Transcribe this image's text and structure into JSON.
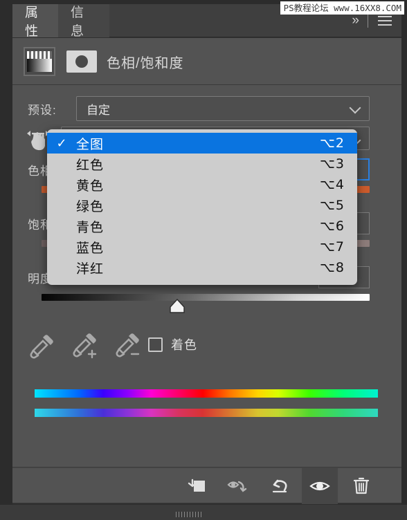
{
  "window": {
    "watermark": "PS教程论坛 www.16XX8.COM"
  },
  "tabs": [
    {
      "label": "属性",
      "active": true
    },
    {
      "label": "信息",
      "active": false
    }
  ],
  "tabbar_controls": {
    "overflow_label": "»",
    "menu_icon": "hamburger-icon"
  },
  "adjustment": {
    "title": "色相/饱和度",
    "layer_thumb_icon": "gradient-adjustment-thumbnail",
    "mask_thumb_icon": "layer-mask-thumbnail"
  },
  "preset": {
    "label": "预设:",
    "value": "自定",
    "chevron_icon": "chevron-down-icon"
  },
  "range": {
    "scrubby_icon": "scrubby-hand-icon",
    "chevron_icon": "chevron-down-icon",
    "selected": "全图"
  },
  "sliders": [
    {
      "name": "hue",
      "label": "色相:",
      "value": "",
      "focused": true
    },
    {
      "name": "saturation",
      "label": "饱和度",
      "value": "",
      "focused": false
    },
    {
      "name": "lightness",
      "label": "明度:",
      "value": "0",
      "focused": false
    }
  ],
  "tools": {
    "eyedropper_icon": "eyedropper-icon",
    "eyedropper_add_icon": "eyedropper-plus-icon",
    "eyedropper_subtract_icon": "eyedropper-minus-icon",
    "colorize_label": "着色",
    "colorize_checked": false
  },
  "menu": {
    "items": [
      {
        "label": "全图",
        "shortcut": "⌥2",
        "checked": true,
        "selected": true
      },
      {
        "label": "红色",
        "shortcut": "⌥3",
        "checked": false,
        "selected": false
      },
      {
        "label": "黄色",
        "shortcut": "⌥4",
        "checked": false,
        "selected": false
      },
      {
        "label": "绿色",
        "shortcut": "⌥5",
        "checked": false,
        "selected": false
      },
      {
        "label": "青色",
        "shortcut": "⌥6",
        "checked": false,
        "selected": false
      },
      {
        "label": "蓝色",
        "shortcut": "⌥7",
        "checked": false,
        "selected": false
      },
      {
        "label": "洋红",
        "shortcut": "⌥8",
        "checked": false,
        "selected": false
      }
    ],
    "check_glyph": "✓"
  },
  "footer": {
    "buttons": [
      {
        "name": "clip-to-layer-button",
        "icon": "clip-to-layer-icon",
        "active": false
      },
      {
        "name": "preview-previous-state-button",
        "icon": "eye-arrow-icon",
        "active": false
      },
      {
        "name": "reset-button",
        "icon": "reset-arrow-icon",
        "active": false
      },
      {
        "name": "toggle-visibility-button",
        "icon": "eye-icon",
        "active": true
      },
      {
        "name": "delete-layer-button",
        "icon": "trash-icon",
        "active": false
      }
    ]
  },
  "colors": {
    "panel_bg": "#535353",
    "tabbar_bg": "#3f3f3f",
    "accent_blue": "#0a74e0",
    "focus_blue": "#2a7fe0",
    "menu_bg": "#cdcdcd",
    "text": "#d8d8d8"
  }
}
